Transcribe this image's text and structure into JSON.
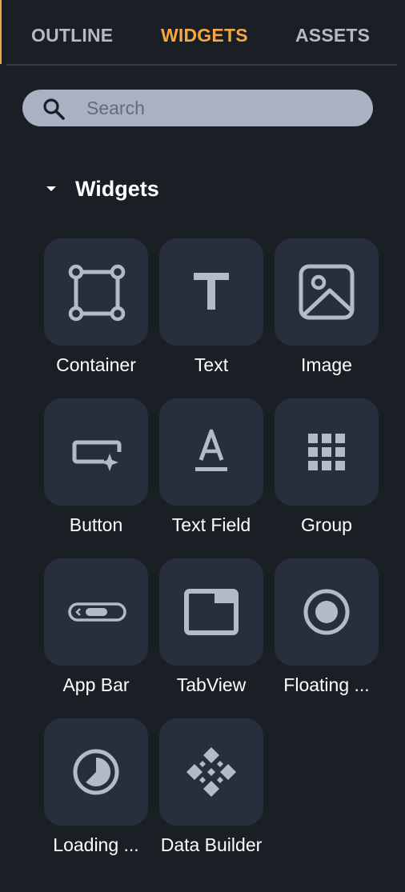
{
  "tabs": {
    "outline": "OUTLINE",
    "widgets": "WIDGETS",
    "assets": "ASSETS"
  },
  "search": {
    "placeholder": "Search",
    "value": ""
  },
  "section": {
    "title": "Widgets",
    "expanded": true
  },
  "widgets": [
    {
      "label": "Container",
      "icon": "container-icon"
    },
    {
      "label": "Text",
      "icon": "text-icon"
    },
    {
      "label": "Image",
      "icon": "image-icon"
    },
    {
      "label": "Button",
      "icon": "button-icon"
    },
    {
      "label": "Text Field",
      "icon": "text-field-icon"
    },
    {
      "label": "Group",
      "icon": "group-icon"
    },
    {
      "label": "App Bar",
      "icon": "app-bar-icon"
    },
    {
      "label": "TabView",
      "icon": "tabview-icon"
    },
    {
      "label": "Floating ...",
      "icon": "floating-action-button-icon"
    },
    {
      "label": "Loading ...",
      "icon": "loading-icon"
    },
    {
      "label": "Data Builder",
      "icon": "data-builder-icon"
    }
  ],
  "colors": {
    "background": "#1a1e25",
    "accent": "#f5a742",
    "tile": "#282f3c",
    "icon": "#b4bac6",
    "search_bg": "#a9b1c3"
  }
}
